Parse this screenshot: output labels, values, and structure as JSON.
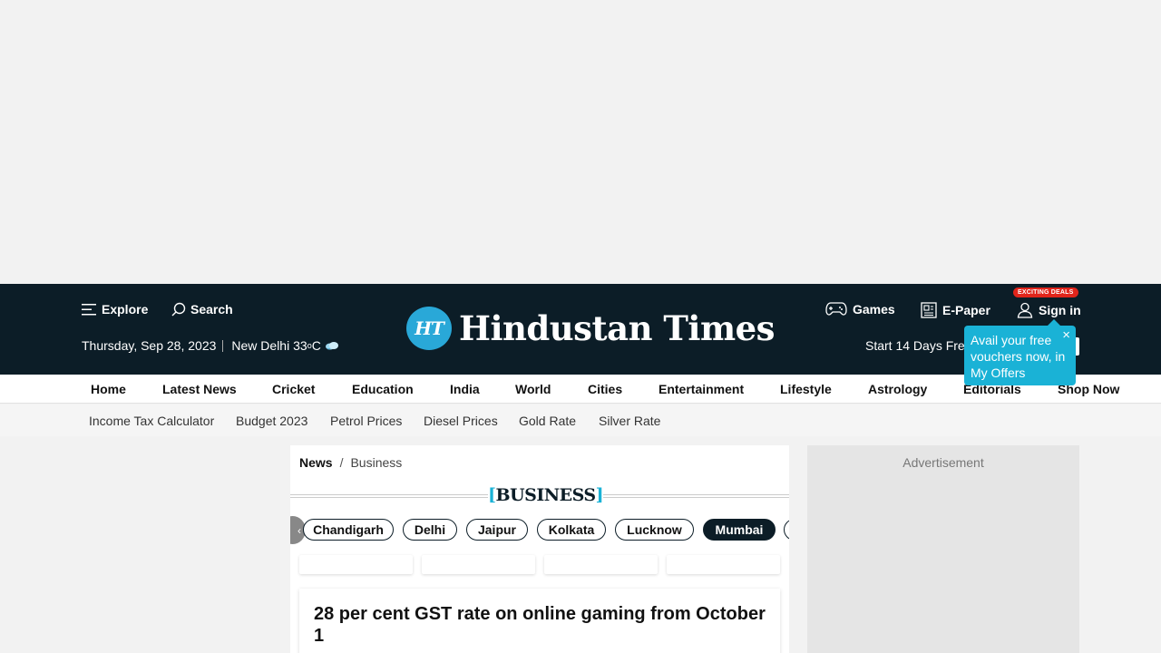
{
  "masthead": {
    "explore_label": "Explore",
    "search_label": "Search",
    "date": "Thursday, Sep 28, 2023",
    "city": "New Delhi",
    "temp_value": "33",
    "temp_degree": "o",
    "temp_unit": "C",
    "logo_monogram": "HT",
    "logo_text": "Hindustan Times",
    "games_label": "Games",
    "epaper_label": "E-Paper",
    "signin_label": "Sign in",
    "deals_badge": "EXCITING DEALS",
    "trial_text": "Start 14 Days Fre",
    "tooltip_text": "Avail your free vouchers now, in My Offers",
    "tooltip_close": "×",
    "brand_color": "#0c1d27",
    "accent_color": "#1ab2d6"
  },
  "main_nav": {
    "items": [
      "Home",
      "Latest News",
      "Cricket",
      "Education",
      "India",
      "World",
      "Cities",
      "Entertainment",
      "Lifestyle",
      "Astrology",
      "Editorials",
      "Shop Now"
    ]
  },
  "sub_nav": {
    "items": [
      "Income Tax Calculator",
      "Budget 2023",
      "Petrol Prices",
      "Diesel Prices",
      "Gold Rate",
      "Silver Rate"
    ]
  },
  "breadcrumb": {
    "root": "News",
    "separator": "/",
    "current": "Business"
  },
  "section": {
    "bracket_open": "[",
    "title": "BUSINESS",
    "bracket_close": "]"
  },
  "city_chips": {
    "items": [
      "Chandigarh",
      "Delhi",
      "Jaipur",
      "Kolkata",
      "Lucknow",
      "Mumbai"
    ],
    "active": "Mumbai",
    "prev_arrow": "‹"
  },
  "article": {
    "title": "28 per cent GST rate on online gaming from October 1"
  },
  "sidebar": {
    "ad_label": "Advertisement"
  }
}
